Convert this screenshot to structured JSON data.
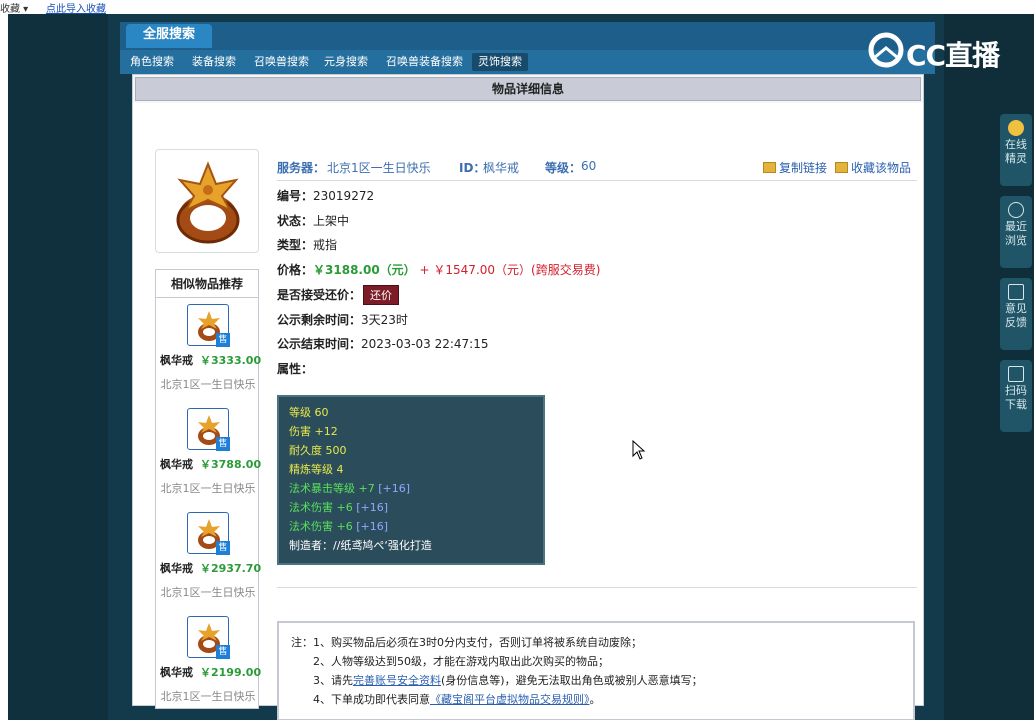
{
  "topbar": {
    "left_text": "收藏 ▾",
    "link_text": "点此导入收藏"
  },
  "tabs": {
    "all_server": "全服搜索",
    "items": [
      "角色搜索",
      "装备搜索",
      "召唤兽搜索",
      "元身搜索",
      "召唤兽装备搜索",
      "灵饰搜索"
    ],
    "active_index": 5
  },
  "logo": {
    "text": "CC直播"
  },
  "header": {
    "title": "物品详细信息"
  },
  "item": {
    "server_label": "服务器：",
    "server": "北京1区一生日快乐",
    "id_label": "ID：",
    "id": "枫华戒",
    "level_label": "等级：",
    "level": "60",
    "copy_link": "复制链接",
    "favorite": "收藏该物品",
    "number_label": "编号：",
    "number": "23019272",
    "status_label": "状态：",
    "status": "上架中",
    "type_label": "类型：",
    "type": "戒指",
    "price_label": "价格：",
    "price": "￥3188.00（元）",
    "plus": "+",
    "fee": "￥1547.00（元）(跨服交易费)",
    "bargain_label": "是否接受还价：",
    "bargain_button": "还价",
    "remain_label": "公示剩余时间：",
    "remain": "3天23时",
    "end_label": "公示结束时间：",
    "end": "2023-03-03 22:47:15",
    "attr_label": "属性："
  },
  "attributes": [
    {
      "text": "等级 60",
      "color": "#e8e84a"
    },
    {
      "text": "伤害 +12",
      "color": "#e8e84a"
    },
    {
      "text": "耐久度 500",
      "color": "#e8e84a"
    },
    {
      "text": "精炼等级 4",
      "color": "#e8e84a"
    },
    {
      "text": "法术暴击等级 +7",
      "extra": "[+16]",
      "color": "#58e05a"
    },
    {
      "text": "法术伤害 +6",
      "extra": "[+16]",
      "color": "#58e05a"
    },
    {
      "text": "法术伤害 +6",
      "extra": "[+16]",
      "color": "#58e05a"
    },
    {
      "text": "制造者：//纸鸢鸠ぺ‘强化打造",
      "color": "#ffffff"
    }
  ],
  "similar": {
    "title": "相似物品推荐",
    "items": [
      {
        "name": "枫华戒",
        "price": "￥3333.00",
        "server": "北京1区一生日快乐",
        "badge": "售"
      },
      {
        "name": "枫华戒",
        "price": "￥3788.00",
        "server": "北京1区一生日快乐",
        "badge": "售"
      },
      {
        "name": "枫华戒",
        "price": "￥2937.70",
        "server": "北京1区一生日快乐",
        "badge": "售"
      },
      {
        "name": "枫华戒",
        "price": "￥2199.00",
        "server": "北京1区一生日快乐",
        "badge": "售"
      }
    ]
  },
  "notes": {
    "line1": "注：1、购买物品后必须在3时0分内支付，否则订单将被系统自动废除；",
    "line2": "2、人物等级达到50级，才能在游戏内取出此次购买的物品；",
    "line3_pre": "3、请先",
    "line3_link": "完善账号安全资料",
    "line3_post": "(身份信息等)，避免无法取出角色或被别人恶意填写；",
    "line4_pre": "4、下单成功即代表同意",
    "line4_link": "《藏宝阁平台虚拟物品交易规则》",
    "line4_post": "。"
  },
  "sidebar": {
    "items": [
      {
        "label": "在线精灵",
        "icon": "avatar-icon"
      },
      {
        "label": "最近浏览",
        "icon": "clock-icon"
      },
      {
        "label": "意见反馈",
        "icon": "edit-icon"
      },
      {
        "label": "扫码下载",
        "icon": "scan-icon"
      }
    ]
  }
}
